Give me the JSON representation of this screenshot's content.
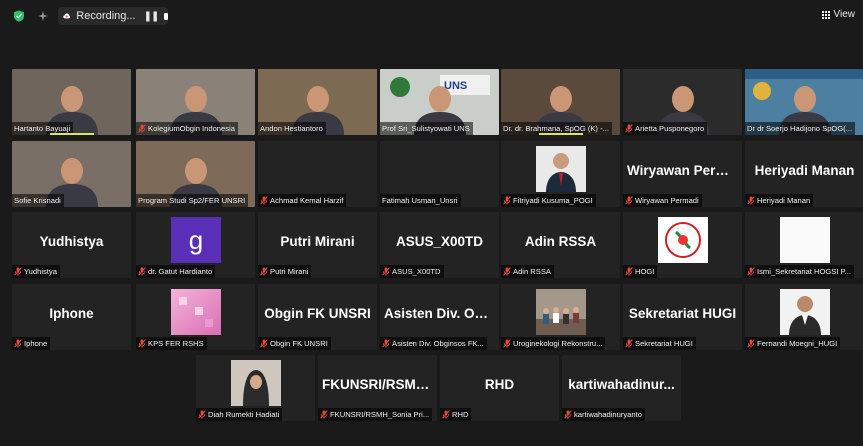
{
  "topbar": {
    "recording_label": "Recording...",
    "view_label": "View"
  },
  "tiles": [
    {
      "name": "Hartanto Bayuaji",
      "muted": false,
      "video": true,
      "bg": "#6f655c"
    },
    {
      "name": "KolegiumObgin Indonesia",
      "muted": true,
      "video": true,
      "bg": "#8a8278"
    },
    {
      "name": "Andon Hestiantoro",
      "muted": false,
      "video": true,
      "bg": "#7d6a52",
      "speaking": true
    },
    {
      "name": "Prof Sri_Sulistyowati UNS",
      "muted": false,
      "video": true,
      "bg": "#c9cfc8"
    },
    {
      "name": "Dr. dr. Brahmana, SpOG (K) -...",
      "muted": false,
      "video": true,
      "bg": "#5a4a3c"
    },
    {
      "name": "Arietta Pusponegoro",
      "muted": true,
      "video": true,
      "bg": "#2b2b2b"
    },
    {
      "name": "Dr dr Soerjo Hadijono SpOG(...",
      "muted": false,
      "video": true,
      "bg": "#4c7fa0"
    },
    {
      "name": "Sofie Krisnadi",
      "muted": false,
      "video": true,
      "bg": "#7a6f66"
    },
    {
      "name": "Program Studi Sp2/FER UNSRI",
      "muted": false,
      "video": true,
      "bg": "#7e6a58"
    },
    {
      "name": "Achmad Kemal Harzif",
      "muted": true,
      "video": false
    },
    {
      "name": "Fatimah Usman_Unsri",
      "muted": false,
      "video": false
    },
    {
      "name": "Fitriyadi Kusuma_POGI",
      "muted": true,
      "video": false,
      "avatar": "portrait"
    },
    {
      "name": "Wiryawan Permadi",
      "big": "Wiryawan Perm...",
      "muted": true,
      "video": false
    },
    {
      "name": "Heriyadi Manan",
      "big": "Heriyadi Manan",
      "muted": true,
      "video": false
    },
    {
      "name": "Yudhistya",
      "big": "Yudhistya",
      "muted": true,
      "video": false
    },
    {
      "name": "dr. Gatut Hardianto",
      "muted": true,
      "video": false,
      "avatar": "letter",
      "letter": "g"
    },
    {
      "name": "Putri Mirani",
      "big": "Putri Mirani",
      "muted": true,
      "video": false
    },
    {
      "name": "ASUS_X00TD",
      "big": "ASUS_X00TD",
      "muted": true,
      "video": false
    },
    {
      "name": "Adin RSSA",
      "big": "Adin RSSA",
      "muted": true,
      "video": false
    },
    {
      "name": "HOGI",
      "muted": true,
      "video": false,
      "avatar": "logo"
    },
    {
      "name": "Ismi_Sekretariat HOGSI P...",
      "muted": true,
      "video": false,
      "avatar": "white"
    },
    {
      "name": "Iphone",
      "big": "Iphone",
      "muted": true,
      "video": false
    },
    {
      "name": "KPS FER RSHS",
      "muted": true,
      "video": false,
      "avatar": "pink"
    },
    {
      "name": "Obgin FK UNSRI",
      "big": "Obgin FK UNSRI",
      "muted": true,
      "video": false
    },
    {
      "name": "Asisten Div. Obginsos FK...",
      "big": "Asisten Div. Obg...",
      "muted": true,
      "video": false
    },
    {
      "name": "Uroginekologi Rekonstru...",
      "muted": true,
      "video": false,
      "avatar": "group"
    },
    {
      "name": "Sekretariat HUGI",
      "big": "Sekretariat HUGI",
      "muted": true,
      "video": false
    },
    {
      "name": "Fernandi Moegni_HUGI",
      "muted": true,
      "video": false,
      "avatar": "portrait2"
    },
    {
      "name": "Diah Rumekti Hadiati",
      "muted": true,
      "video": false,
      "avatar": "hijab"
    },
    {
      "name": "FKUNSRI/RSMH_Sonia Pri...",
      "big": "FKUNSRI/RSMH...",
      "muted": true,
      "video": false
    },
    {
      "name": "RHD",
      "big": "RHD",
      "muted": true,
      "video": false
    },
    {
      "name": "kartiwahadinuryanto",
      "big": "kartiwahadinur...",
      "muted": true,
      "video": false
    }
  ],
  "colors": {
    "background": "#1a1a1a",
    "tile": "#232323",
    "speaking_border": "#c6e84a",
    "mute_red": "#e5483d"
  }
}
